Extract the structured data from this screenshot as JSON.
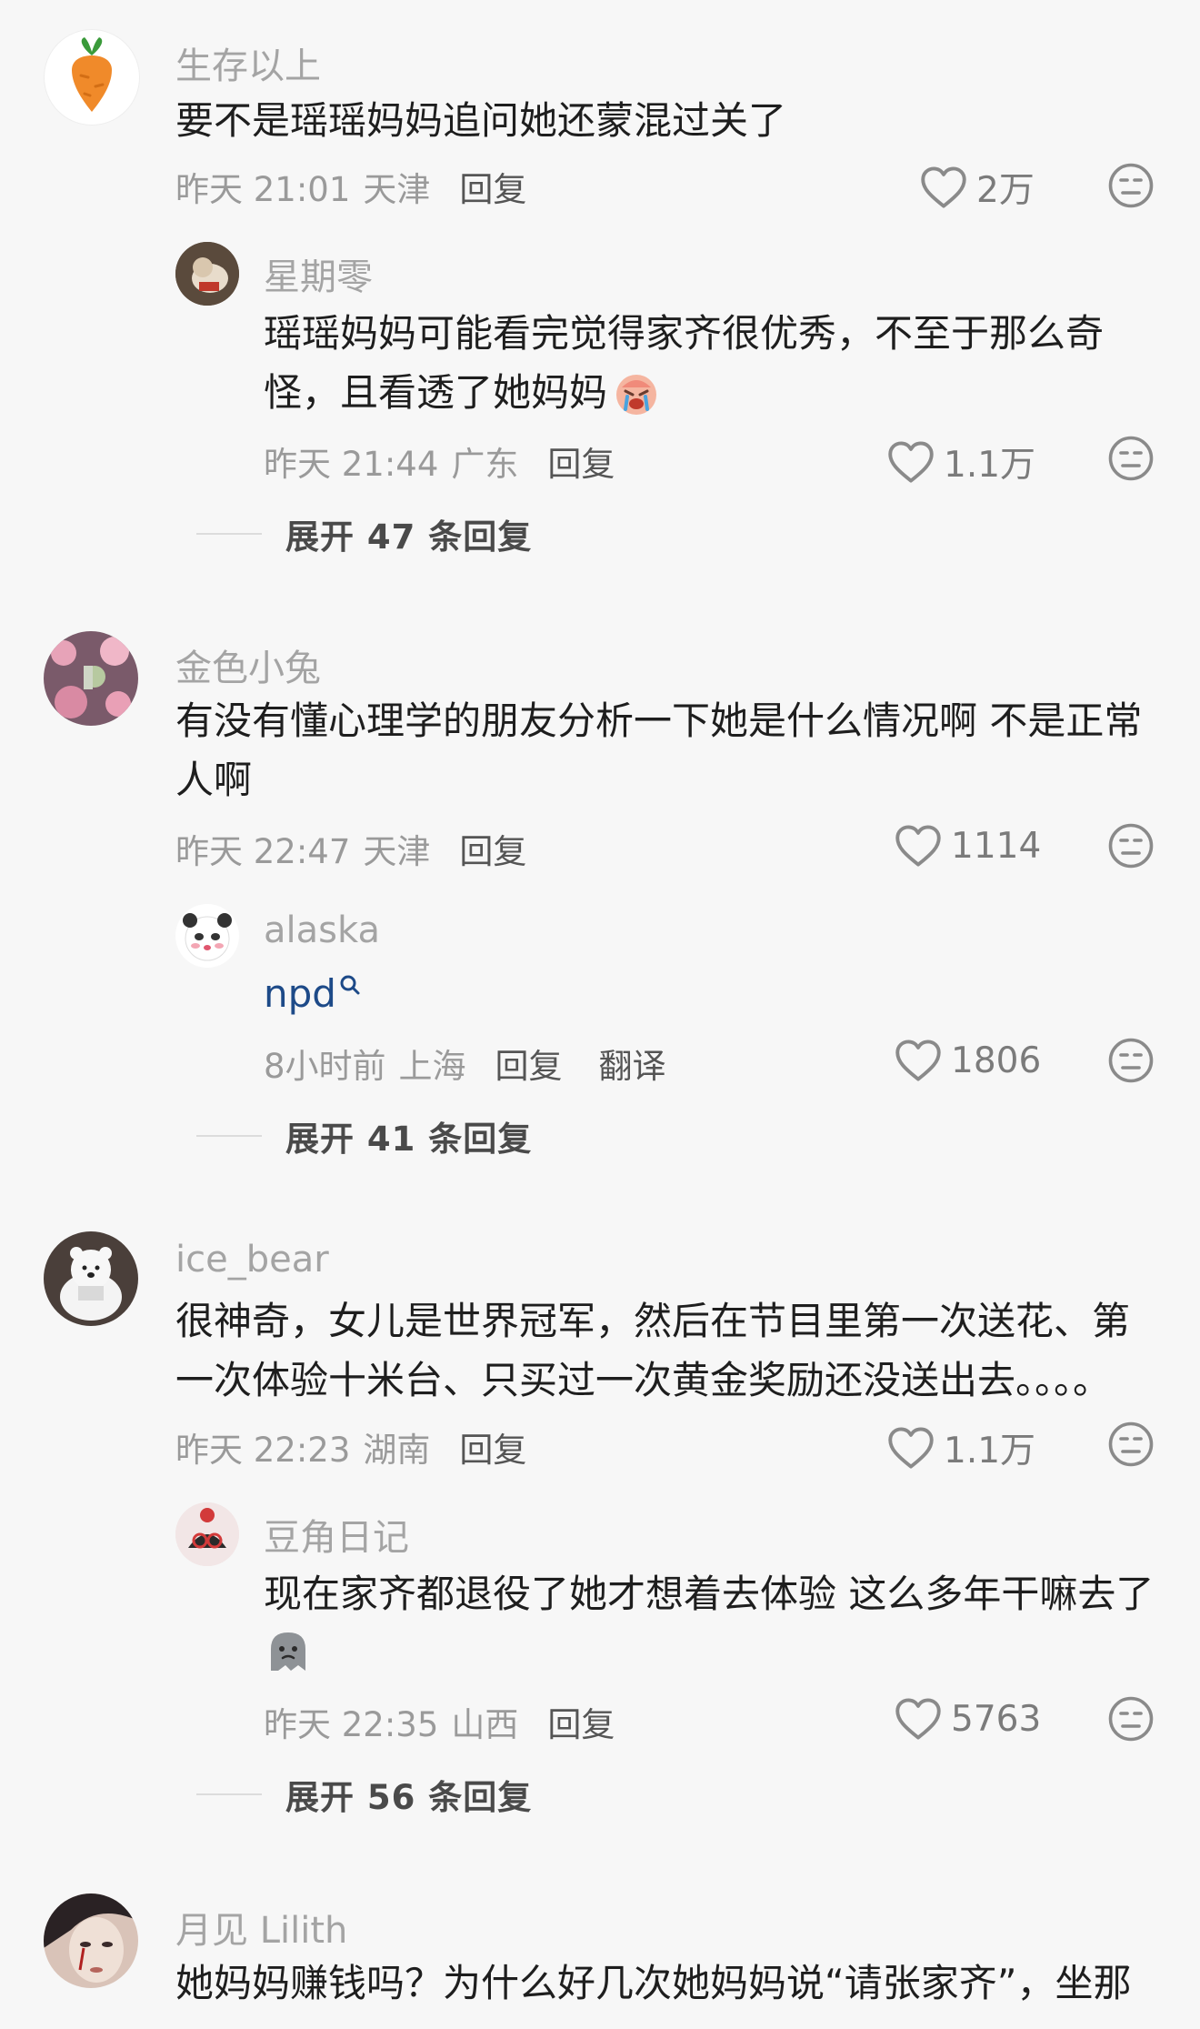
{
  "comments": [
    {
      "username": "生存以上",
      "text": "要不是瑶瑶妈妈追问她还蒙混过关了",
      "time": "昨天 21:01",
      "location": "天津",
      "reply_label": "回复",
      "likes": "2万",
      "avatar_icon": "carrot-icon",
      "replies": [
        {
          "username": "星期零",
          "text_line1": "瑶瑶妈妈可能看完觉得家齐很优秀，不至于那么奇",
          "text_line2": "怪，且看透了她妈妈",
          "emoji": "crying-face-icon",
          "time": "昨天 21:44",
          "location": "广东",
          "reply_label": "回复",
          "likes": "1.1万"
        }
      ],
      "expand": "展开 47 条回复"
    },
    {
      "username": "金色小兔",
      "text_line1": "有没有懂心理学的朋友分析一下她是什么情况啊 不是正常",
      "text_line2": "人啊",
      "time": "昨天 22:47",
      "location": "天津",
      "reply_label": "回复",
      "likes": "1114",
      "replies": [
        {
          "username": "alaska",
          "text": "npd",
          "time": "8小时前",
          "location": "上海",
          "reply_label": "回复",
          "translate_label": "翻译",
          "likes": "1806"
        }
      ],
      "expand": "展开 41 条回复"
    },
    {
      "username": "ice_bear",
      "text_line1": "很神奇，女儿是世界冠军，然后在节目里第一次送花、第",
      "text_line2": "一次体验十米台、只买过一次黄金奖励还没送出去。。。。",
      "time": "昨天 22:23",
      "location": "湖南",
      "reply_label": "回复",
      "likes": "1.1万",
      "replies": [
        {
          "username": "豆角日记",
          "text": "现在家齐都退役了她才想着去体验 这么多年干嘛去了",
          "emoji": "sad-ghost-icon",
          "time": "昨天 22:35",
          "location": "山西",
          "reply_label": "回复",
          "likes": "5763"
        }
      ],
      "expand": "展开 56 条回复"
    },
    {
      "username": "月见 Lilith",
      "text": "她妈妈赚钱吗？为什么好几次她妈妈说“请张家齐”，坐那"
    }
  ],
  "colors": {
    "background": "#f7f7f7",
    "username": "#a4a4a4",
    "meta": "#9a9a9a",
    "link": "#1d4a88"
  }
}
